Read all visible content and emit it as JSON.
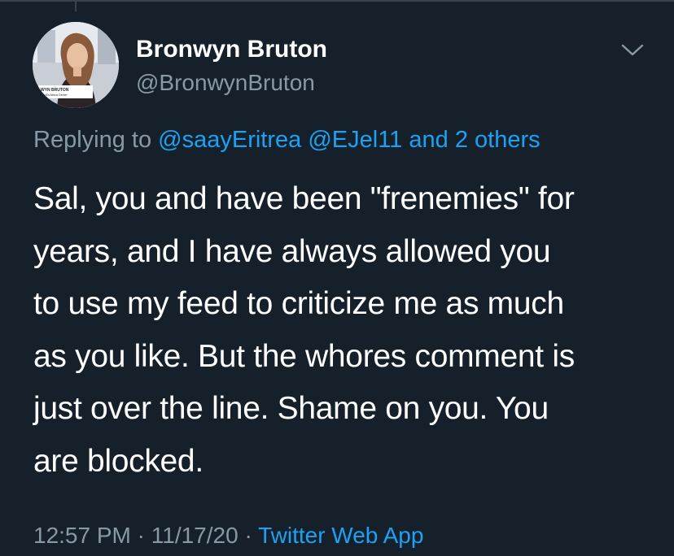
{
  "tweet": {
    "author": {
      "display_name": "Bronwyn Bruton",
      "handle": "@BronwynBruton",
      "avatar_caption_line1": "WYN BRUTON",
      "avatar_caption_line2": "...ncil's Africa Center"
    },
    "menu_icon": "chevron-down-icon",
    "reply": {
      "prefix": "Replying to",
      "mentions": [
        "@saayEritrea",
        "@EJel11"
      ],
      "conjunction": "and",
      "others": "2 others"
    },
    "text": "Sal, you and have been \"frenemies\" for\nyears, and I have always allowed you\nto use my feed to criticize me as much\nas you like. But the whores comment is\njust over the line. Shame on you. You\nare blocked.",
    "time": "12:57 PM",
    "separator": "·",
    "date": "11/17/20",
    "source": "Twitter Web App"
  },
  "colors": {
    "background": "#15202b",
    "text_primary": "#ffffff",
    "text_secondary": "#8899a6",
    "link": "#1da1f2",
    "border": "#38444d"
  }
}
